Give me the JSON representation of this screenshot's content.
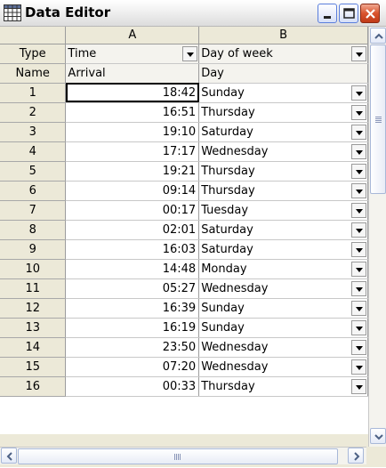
{
  "window": {
    "title": "Data Editor"
  },
  "columns": {
    "row_header": "",
    "letters": [
      "A",
      "B"
    ],
    "types": [
      "Time",
      "Day of week"
    ],
    "names": [
      "Arrival",
      "Day"
    ]
  },
  "meta_labels": {
    "type": "Type",
    "name": "Name"
  },
  "rows": [
    {
      "n": "1",
      "time": "18:42",
      "day": "Sunday"
    },
    {
      "n": "2",
      "time": "16:51",
      "day": "Thursday"
    },
    {
      "n": "3",
      "time": "19:10",
      "day": "Saturday"
    },
    {
      "n": "4",
      "time": "17:17",
      "day": "Wednesday"
    },
    {
      "n": "5",
      "time": "19:21",
      "day": "Thursday"
    },
    {
      "n": "6",
      "time": "09:14",
      "day": "Thursday"
    },
    {
      "n": "7",
      "time": "00:17",
      "day": "Tuesday"
    },
    {
      "n": "8",
      "time": "02:01",
      "day": "Saturday"
    },
    {
      "n": "9",
      "time": "16:03",
      "day": "Saturday"
    },
    {
      "n": "10",
      "time": "14:48",
      "day": "Monday"
    },
    {
      "n": "11",
      "time": "05:27",
      "day": "Wednesday"
    },
    {
      "n": "12",
      "time": "16:39",
      "day": "Sunday"
    },
    {
      "n": "13",
      "time": "16:19",
      "day": "Sunday"
    },
    {
      "n": "14",
      "time": "23:50",
      "day": "Wednesday"
    },
    {
      "n": "15",
      "time": "07:20",
      "day": "Wednesday"
    },
    {
      "n": "16",
      "time": "00:33",
      "day": "Thursday"
    }
  ]
}
